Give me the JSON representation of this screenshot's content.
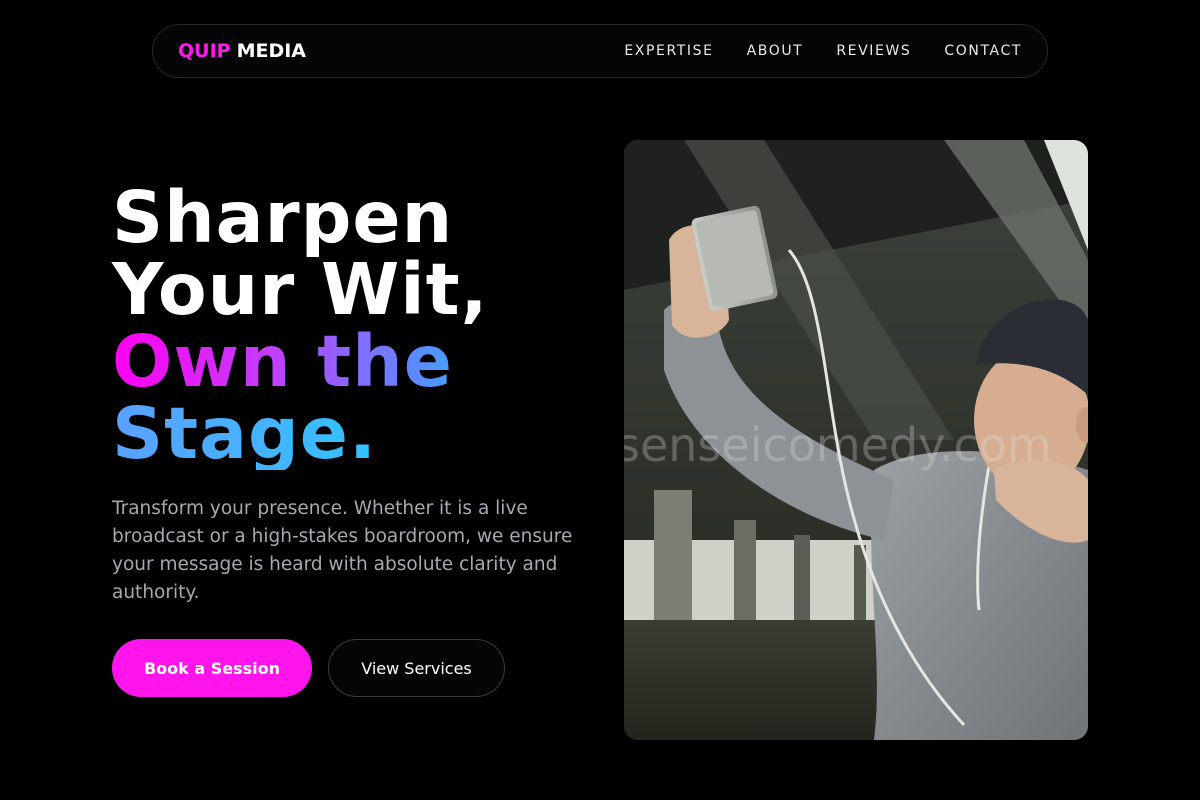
{
  "brand": {
    "part1": "QUIP",
    "part2": "MEDIA"
  },
  "nav": {
    "links": [
      "EXPERTISE",
      "ABOUT",
      "REVIEWS",
      "CONTACT"
    ]
  },
  "hero": {
    "title_line1": "Sharpen",
    "title_line2": "Your Wit,",
    "title_line3": "Own the",
    "title_line4": "Stage.",
    "description": "Transform your presence. Whether it is a live broadcast or a high-stakes boardroom, we ensure your message is heard with absolute clarity and authority.",
    "primary_button": "Book a Session",
    "secondary_button": "View Services"
  },
  "photo": {
    "watermark": "senseicomedy.com"
  },
  "colors": {
    "background": "#000000",
    "accent_magenta": "#ff14ec",
    "accent_cyan": "#08e8ff",
    "text_muted": "#a8a8b2"
  }
}
